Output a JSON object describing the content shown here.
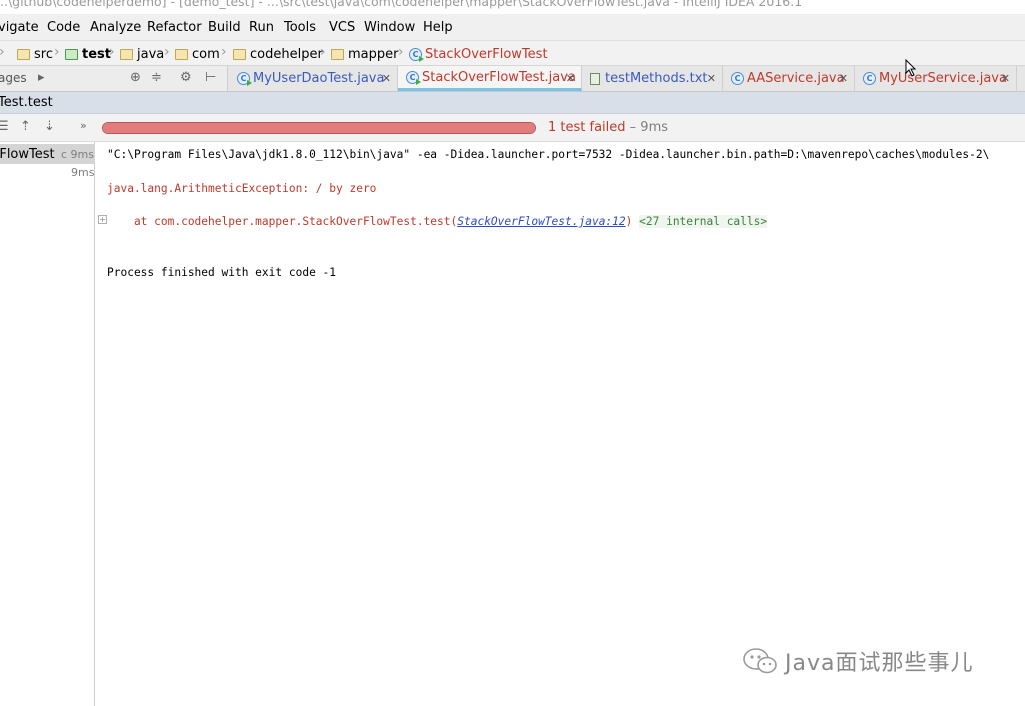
{
  "window": {
    "title": "...\\github\\codehelperdemo] - [demo_test] - ...\\src\\test\\java\\com\\codehelper\\mapper\\StackOverFlowTest.java - IntelliJ IDEA 2016.1"
  },
  "menu": [
    "vigate",
    "Code",
    "Analyze",
    "Refactor",
    "Build",
    "Run",
    "Tools",
    "VCS",
    "Window",
    "Help"
  ],
  "breadcrumbs": [
    "src",
    "test",
    "java",
    "com",
    "codehelper",
    "mapper",
    "StackOverFlowTest"
  ],
  "tool_window_label": "ages",
  "tabs": [
    {
      "label": "MyUserDaoTest.java",
      "color": "#3a5bbf"
    },
    {
      "label": "StackOverFlowTest.java",
      "color": "#c0392b",
      "active": true
    },
    {
      "label": "testMethods.txt",
      "color": "#3a5bbf"
    },
    {
      "label": "AAService.java",
      "color": "#c0392b"
    },
    {
      "label": "MyUserService.java",
      "color": "#c0392b"
    }
  ],
  "run_header": "Test.test",
  "run": {
    "status_text": "1 test failed",
    "duration": "– 9ms",
    "progress_fraction": 1.0
  },
  "tree": {
    "item_label": "rFlowTest",
    "item_duration": "c 9ms",
    "child_time": "9ms"
  },
  "console": {
    "command": "\"C:\\Program Files\\Java\\jdk1.8.0_112\\bin\\java\" -ea -Didea.launcher.port=7532 -Didea.launcher.bin.path=D:\\mavenrepo\\caches\\modules-2\\",
    "exception": "java.lang.ArithmeticException: / by zero",
    "stack_prefix": "    at com.codehelper.mapper.StackOverFlowTest.test(",
    "stack_link": "StackOverFlowTest.java:12",
    "stack_suffix": ")",
    "internal_calls": "<27 internal calls>",
    "exit": "Process finished with exit code -1"
  },
  "watermark": "Java面试那些事儿",
  "colors": {
    "fail_red": "#c0392b",
    "progress_fill": "#e37c7c",
    "link_blue": "#2c4bc7",
    "active_tab_underline": "#7bc3e3"
  }
}
